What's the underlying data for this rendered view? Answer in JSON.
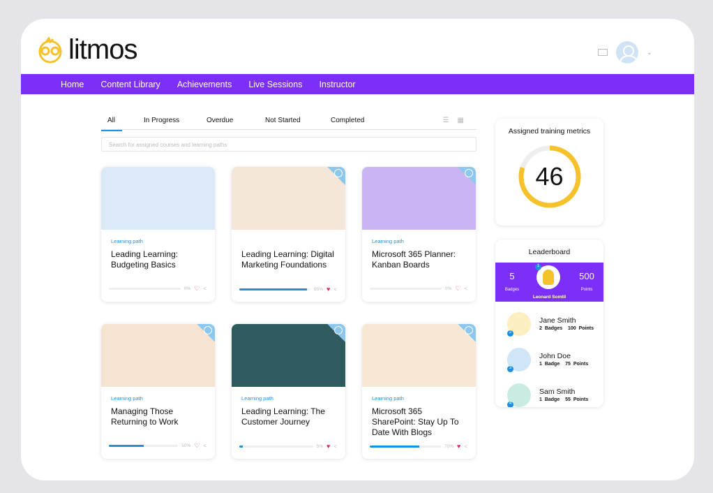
{
  "brand": {
    "name": "litmos",
    "accent": "#7b2ff7",
    "logo_color": "#f6c22b"
  },
  "nav": [
    "Home",
    "Content Library",
    "Achievements",
    "Live Sessions",
    "Instructor"
  ],
  "tabs": [
    "All",
    "In Progress",
    "Overdue",
    "Not Started",
    "Completed"
  ],
  "search": {
    "placeholder": "Search for assigned courses and learning paths"
  },
  "cards": [
    {
      "kind": "Learning path",
      "title": "Leading Learning: Budgeting Basics",
      "progress": 0,
      "pct": "0%",
      "liked": false,
      "bg": "#dbe9f7"
    },
    {
      "kind": "",
      "title": "Leading Learning: Digital Marketing Foundations",
      "progress": 95,
      "pct": "95%",
      "liked": true,
      "bg": "#f4e6d8"
    },
    {
      "kind": "Learning path",
      "title": "Microsoft 365 Planner: Kanban Boards",
      "progress": 0,
      "pct": "0%",
      "liked": false,
      "bg": "#c9b5f2"
    },
    {
      "kind": "Learning path",
      "title": "Managing Those Returning to Work",
      "progress": 50,
      "pct": "50%",
      "liked": false,
      "bg": "#f6e3cf"
    },
    {
      "kind": "Learning path",
      "title": "Leading Learning: The Customer Journey",
      "progress": 5,
      "pct": "5%",
      "liked": true,
      "bg": "#2f5a5e"
    },
    {
      "kind": "Learning path",
      "title": "Microsoft 365 SharePoint: Stay Up To Date With Blogs",
      "progress": 70,
      "pct": "70%",
      "liked": true,
      "bg": "#f6e8d4"
    }
  ],
  "metrics": {
    "title": "Assigned training metrics",
    "value": "46",
    "fraction": 0.8,
    "color": "#f6c22b"
  },
  "leaderboard": {
    "title": "Leaderboard",
    "leader": {
      "rank": "1",
      "name": "Leonard Somtil",
      "badges": "5",
      "badges_label": "Badges",
      "points": "500",
      "points_label": "Points"
    },
    "rows": [
      {
        "rank": "2",
        "name": "Jane Smith",
        "badges": "2 Badges",
        "points": "100 Points",
        "color": "#fbeec0"
      },
      {
        "rank": "3",
        "name": "John Doe",
        "badges": "1 Badge",
        "points": "75 Points",
        "color": "#cfe6f8"
      },
      {
        "rank": "4",
        "name": "Sam Smith",
        "badges": "1 Badge",
        "points": "55 Points",
        "color": "#c8ece2"
      }
    ]
  }
}
